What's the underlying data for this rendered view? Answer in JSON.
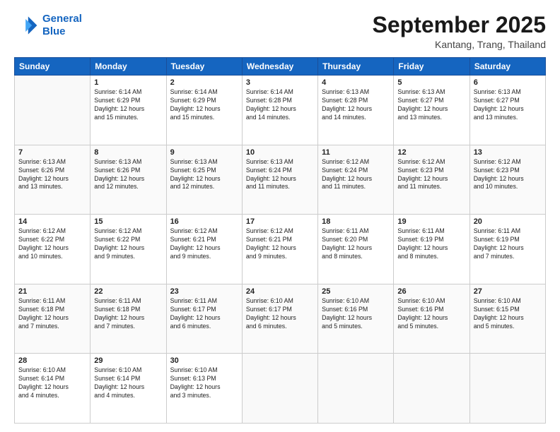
{
  "header": {
    "logo_line1": "General",
    "logo_line2": "Blue",
    "month": "September 2025",
    "location": "Kantang, Trang, Thailand"
  },
  "days_of_week": [
    "Sunday",
    "Monday",
    "Tuesday",
    "Wednesday",
    "Thursday",
    "Friday",
    "Saturday"
  ],
  "weeks": [
    [
      {
        "day": "",
        "info": ""
      },
      {
        "day": "1",
        "info": "Sunrise: 6:14 AM\nSunset: 6:29 PM\nDaylight: 12 hours\nand 15 minutes."
      },
      {
        "day": "2",
        "info": "Sunrise: 6:14 AM\nSunset: 6:29 PM\nDaylight: 12 hours\nand 15 minutes."
      },
      {
        "day": "3",
        "info": "Sunrise: 6:14 AM\nSunset: 6:28 PM\nDaylight: 12 hours\nand 14 minutes."
      },
      {
        "day": "4",
        "info": "Sunrise: 6:13 AM\nSunset: 6:28 PM\nDaylight: 12 hours\nand 14 minutes."
      },
      {
        "day": "5",
        "info": "Sunrise: 6:13 AM\nSunset: 6:27 PM\nDaylight: 12 hours\nand 13 minutes."
      },
      {
        "day": "6",
        "info": "Sunrise: 6:13 AM\nSunset: 6:27 PM\nDaylight: 12 hours\nand 13 minutes."
      }
    ],
    [
      {
        "day": "7",
        "info": "Sunrise: 6:13 AM\nSunset: 6:26 PM\nDaylight: 12 hours\nand 13 minutes."
      },
      {
        "day": "8",
        "info": "Sunrise: 6:13 AM\nSunset: 6:26 PM\nDaylight: 12 hours\nand 12 minutes."
      },
      {
        "day": "9",
        "info": "Sunrise: 6:13 AM\nSunset: 6:25 PM\nDaylight: 12 hours\nand 12 minutes."
      },
      {
        "day": "10",
        "info": "Sunrise: 6:13 AM\nSunset: 6:24 PM\nDaylight: 12 hours\nand 11 minutes."
      },
      {
        "day": "11",
        "info": "Sunrise: 6:12 AM\nSunset: 6:24 PM\nDaylight: 12 hours\nand 11 minutes."
      },
      {
        "day": "12",
        "info": "Sunrise: 6:12 AM\nSunset: 6:23 PM\nDaylight: 12 hours\nand 11 minutes."
      },
      {
        "day": "13",
        "info": "Sunrise: 6:12 AM\nSunset: 6:23 PM\nDaylight: 12 hours\nand 10 minutes."
      }
    ],
    [
      {
        "day": "14",
        "info": "Sunrise: 6:12 AM\nSunset: 6:22 PM\nDaylight: 12 hours\nand 10 minutes."
      },
      {
        "day": "15",
        "info": "Sunrise: 6:12 AM\nSunset: 6:22 PM\nDaylight: 12 hours\nand 9 minutes."
      },
      {
        "day": "16",
        "info": "Sunrise: 6:12 AM\nSunset: 6:21 PM\nDaylight: 12 hours\nand 9 minutes."
      },
      {
        "day": "17",
        "info": "Sunrise: 6:12 AM\nSunset: 6:21 PM\nDaylight: 12 hours\nand 9 minutes."
      },
      {
        "day": "18",
        "info": "Sunrise: 6:11 AM\nSunset: 6:20 PM\nDaylight: 12 hours\nand 8 minutes."
      },
      {
        "day": "19",
        "info": "Sunrise: 6:11 AM\nSunset: 6:19 PM\nDaylight: 12 hours\nand 8 minutes."
      },
      {
        "day": "20",
        "info": "Sunrise: 6:11 AM\nSunset: 6:19 PM\nDaylight: 12 hours\nand 7 minutes."
      }
    ],
    [
      {
        "day": "21",
        "info": "Sunrise: 6:11 AM\nSunset: 6:18 PM\nDaylight: 12 hours\nand 7 minutes."
      },
      {
        "day": "22",
        "info": "Sunrise: 6:11 AM\nSunset: 6:18 PM\nDaylight: 12 hours\nand 7 minutes."
      },
      {
        "day": "23",
        "info": "Sunrise: 6:11 AM\nSunset: 6:17 PM\nDaylight: 12 hours\nand 6 minutes."
      },
      {
        "day": "24",
        "info": "Sunrise: 6:10 AM\nSunset: 6:17 PM\nDaylight: 12 hours\nand 6 minutes."
      },
      {
        "day": "25",
        "info": "Sunrise: 6:10 AM\nSunset: 6:16 PM\nDaylight: 12 hours\nand 5 minutes."
      },
      {
        "day": "26",
        "info": "Sunrise: 6:10 AM\nSunset: 6:16 PM\nDaylight: 12 hours\nand 5 minutes."
      },
      {
        "day": "27",
        "info": "Sunrise: 6:10 AM\nSunset: 6:15 PM\nDaylight: 12 hours\nand 5 minutes."
      }
    ],
    [
      {
        "day": "28",
        "info": "Sunrise: 6:10 AM\nSunset: 6:14 PM\nDaylight: 12 hours\nand 4 minutes."
      },
      {
        "day": "29",
        "info": "Sunrise: 6:10 AM\nSunset: 6:14 PM\nDaylight: 12 hours\nand 4 minutes."
      },
      {
        "day": "30",
        "info": "Sunrise: 6:10 AM\nSunset: 6:13 PM\nDaylight: 12 hours\nand 3 minutes."
      },
      {
        "day": "",
        "info": ""
      },
      {
        "day": "",
        "info": ""
      },
      {
        "day": "",
        "info": ""
      },
      {
        "day": "",
        "info": ""
      }
    ]
  ]
}
